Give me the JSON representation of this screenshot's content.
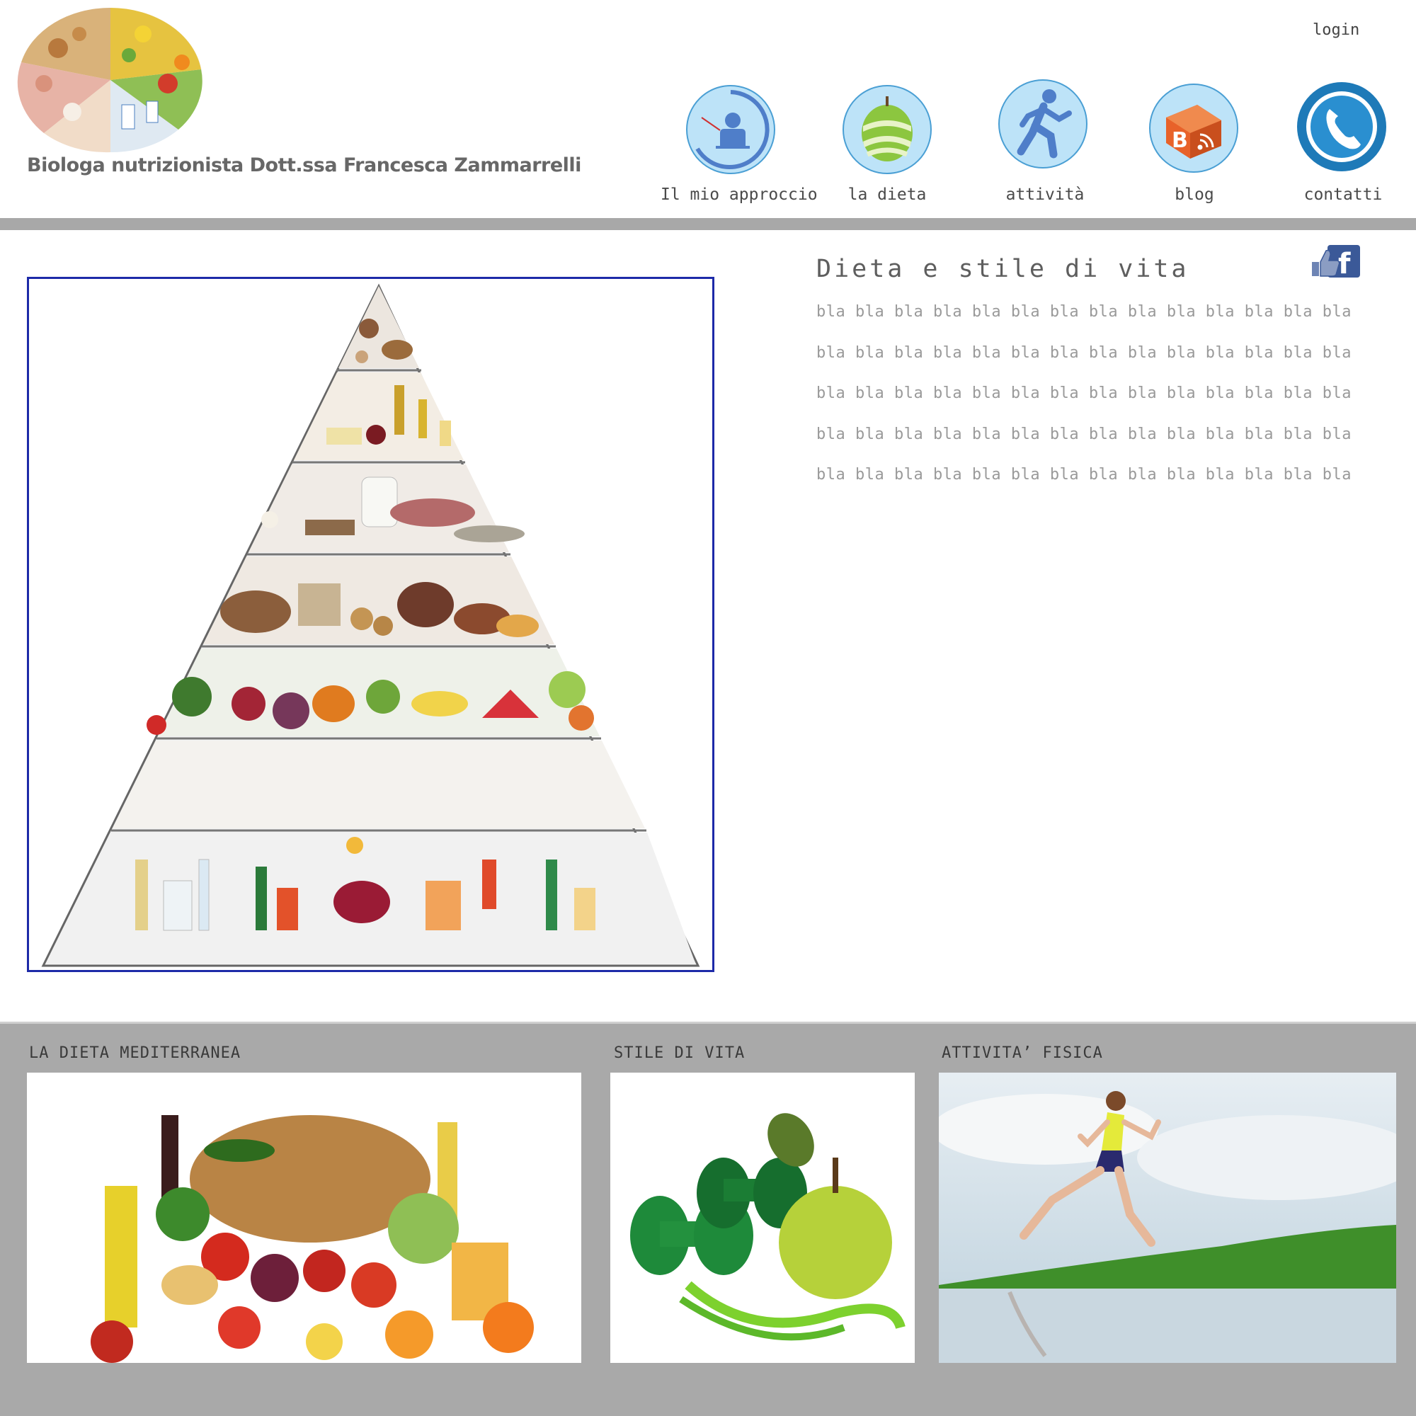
{
  "header": {
    "brand_name": "Biologa nutrizionista Dott.ssa Francesca Zammarrelli",
    "login_label": "login"
  },
  "nav": {
    "items": [
      {
        "label": "Il mio approccio",
        "icon": "presenter-icon"
      },
      {
        "label": "la dieta",
        "icon": "apple-peel-icon"
      },
      {
        "label": "attività",
        "icon": "runner-icon"
      },
      {
        "label": "blog",
        "icon": "blogger-rss-icon"
      },
      {
        "label": "contatti",
        "icon": "phone-icon"
      }
    ]
  },
  "main": {
    "title": "Dieta e stile di vita",
    "lines": [
      "bla bla bla bla bla bla bla bla bla bla bla bla bla bla",
      "bla bla bla bla bla bla bla bla bla bla bla bla bla bla",
      "bla bla bla bla bla bla bla bla bla bla bla bla bla bla",
      "bla bla bla bla bla bla bla bla bla bla bla bla bla bla",
      "bla bla bla bla bla bla bla bla bla bla bla bla bla bla"
    ],
    "facebook_icon": "facebook-like-icon"
  },
  "footer": {
    "cards": [
      {
        "title": "LA DIETA MEDITERRANEA"
      },
      {
        "title": "STILE DI VITA"
      },
      {
        "title": "ATTIVITA’ FISICA"
      }
    ]
  },
  "colors": {
    "rule_gray": "#a8a8a8",
    "frame_blue": "#1d2aa8",
    "nav_circle": "#bde3f8",
    "nav_icon": "#4f7ec9"
  }
}
